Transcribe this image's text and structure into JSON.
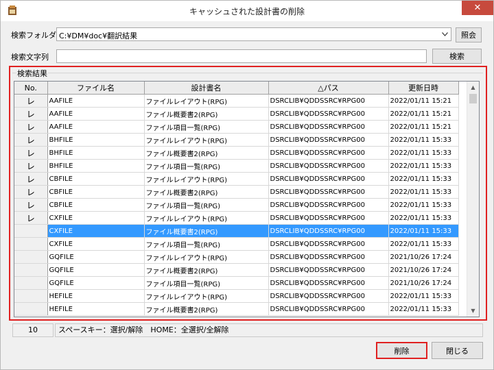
{
  "window": {
    "title": "キャッシュされた設計書の削除",
    "close_glyph": "✕"
  },
  "search": {
    "folder_label": "検索フォルダ",
    "folder_value": "C:¥DM¥doc¥翻訳結果",
    "browse_button": "照会",
    "text_label": "検索文字列",
    "text_value": "",
    "search_button": "検索"
  },
  "results": {
    "group_label": "検索結果",
    "columns": {
      "no": "No.",
      "file": "ファイル名",
      "design": "設計書名",
      "path": "△パス",
      "date": "更新日時"
    },
    "rows": [
      {
        "check": "レ",
        "file": "AAFILE",
        "design": "ファイルレイアウト(RPG)",
        "path": "DSRCLIB¥QDDSSRC¥RPG00",
        "date": "2022/01/11 15:21"
      },
      {
        "check": "レ",
        "file": "AAFILE",
        "design": "ファイル概要書2(RPG)",
        "path": "DSRCLIB¥QDDSSRC¥RPG00",
        "date": "2022/01/11 15:21"
      },
      {
        "check": "レ",
        "file": "AAFILE",
        "design": "ファイル項目一覧(RPG)",
        "path": "DSRCLIB¥QDDSSRC¥RPG00",
        "date": "2022/01/11 15:21"
      },
      {
        "check": "レ",
        "file": "BHFILE",
        "design": "ファイルレイアウト(RPG)",
        "path": "DSRCLIB¥QDDSSRC¥RPG00",
        "date": "2022/01/11 15:33"
      },
      {
        "check": "レ",
        "file": "BHFILE",
        "design": "ファイル概要書2(RPG)",
        "path": "DSRCLIB¥QDDSSRC¥RPG00",
        "date": "2022/01/11 15:33"
      },
      {
        "check": "レ",
        "file": "BHFILE",
        "design": "ファイル項目一覧(RPG)",
        "path": "DSRCLIB¥QDDSSRC¥RPG00",
        "date": "2022/01/11 15:33"
      },
      {
        "check": "レ",
        "file": "CBFILE",
        "design": "ファイルレイアウト(RPG)",
        "path": "DSRCLIB¥QDDSSRC¥RPG00",
        "date": "2022/01/11 15:33"
      },
      {
        "check": "レ",
        "file": "CBFILE",
        "design": "ファイル概要書2(RPG)",
        "path": "DSRCLIB¥QDDSSRC¥RPG00",
        "date": "2022/01/11 15:33"
      },
      {
        "check": "レ",
        "file": "CBFILE",
        "design": "ファイル項目一覧(RPG)",
        "path": "DSRCLIB¥QDDSSRC¥RPG00",
        "date": "2022/01/11 15:33"
      },
      {
        "check": "レ",
        "file": "CXFILE",
        "design": "ファイルレイアウト(RPG)",
        "path": "DSRCLIB¥QDDSSRC¥RPG00",
        "date": "2022/01/11 15:33"
      },
      {
        "check": "",
        "file": "CXFILE",
        "design": "ファイル概要書2(RPG)",
        "path": "DSRCLIB¥QDDSSRC¥RPG00",
        "date": "2022/01/11 15:33",
        "selected": true
      },
      {
        "check": "",
        "file": "CXFILE",
        "design": "ファイル項目一覧(RPG)",
        "path": "DSRCLIB¥QDDSSRC¥RPG00",
        "date": "2022/01/11 15:33"
      },
      {
        "check": "",
        "file": "GQFILE",
        "design": "ファイルレイアウト(RPG)",
        "path": "DSRCLIB¥QDDSSRC¥RPG00",
        "date": "2021/10/26 17:24"
      },
      {
        "check": "",
        "file": "GQFILE",
        "design": "ファイル概要書2(RPG)",
        "path": "DSRCLIB¥QDDSSRC¥RPG00",
        "date": "2021/10/26 17:24"
      },
      {
        "check": "",
        "file": "GQFILE",
        "design": "ファイル項目一覧(RPG)",
        "path": "DSRCLIB¥QDDSSRC¥RPG00",
        "date": "2021/10/26 17:24"
      },
      {
        "check": "",
        "file": "HEFILE",
        "design": "ファイルレイアウト(RPG)",
        "path": "DSRCLIB¥QDDSSRC¥RPG00",
        "date": "2022/01/11 15:33"
      },
      {
        "check": "",
        "file": "HEFILE",
        "design": "ファイル概要書2(RPG)",
        "path": "DSRCLIB¥QDDSSRC¥RPG00",
        "date": "2022/01/11 15:33"
      }
    ]
  },
  "status": {
    "count": "10",
    "hint": "スペースキー：選択/解除　HOME：全選択/全解除"
  },
  "footer": {
    "delete_button": "削除",
    "close_button": "閉じる"
  },
  "colors": {
    "highlight": "#e02020",
    "selection": "#3399ff"
  }
}
